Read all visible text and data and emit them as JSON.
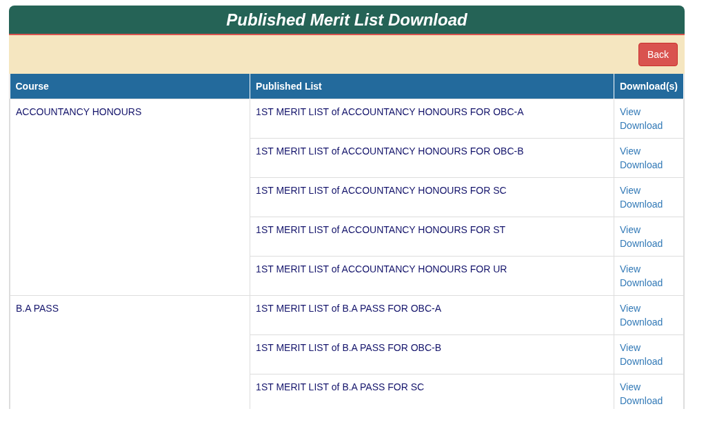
{
  "header": {
    "title": "Published Merit List Download"
  },
  "toolbar": {
    "back_button": "Back"
  },
  "table": {
    "columns": [
      "Course",
      "Published List",
      "Download(s)"
    ],
    "groups": [
      {
        "course": "ACCOUNTANCY HONOURS",
        "rows": [
          {
            "list": "1ST MERIT LIST of ACCOUNTANCY HONOURS FOR OBC-A",
            "view": "View",
            "download": "Download"
          },
          {
            "list": "1ST MERIT LIST of ACCOUNTANCY HONOURS FOR OBC-B",
            "view": "View",
            "download": "Download"
          },
          {
            "list": "1ST MERIT LIST of ACCOUNTANCY HONOURS FOR SC",
            "view": "View",
            "download": "Download"
          },
          {
            "list": "1ST MERIT LIST of ACCOUNTANCY HONOURS FOR ST",
            "view": "View",
            "download": "Download"
          },
          {
            "list": "1ST MERIT LIST of ACCOUNTANCY HONOURS FOR UR",
            "view": "View",
            "download": "Download"
          }
        ]
      },
      {
        "course": "B.A PASS",
        "rows": [
          {
            "list": "1ST MERIT LIST of B.A PASS FOR OBC-A",
            "view": "View",
            "download": "Download"
          },
          {
            "list": "1ST MERIT LIST of B.A PASS FOR OBC-B",
            "view": "View",
            "download": "Download"
          },
          {
            "list": "1ST MERIT LIST of B.A PASS FOR SC",
            "view": "View",
            "download": "Download"
          }
        ]
      }
    ]
  }
}
